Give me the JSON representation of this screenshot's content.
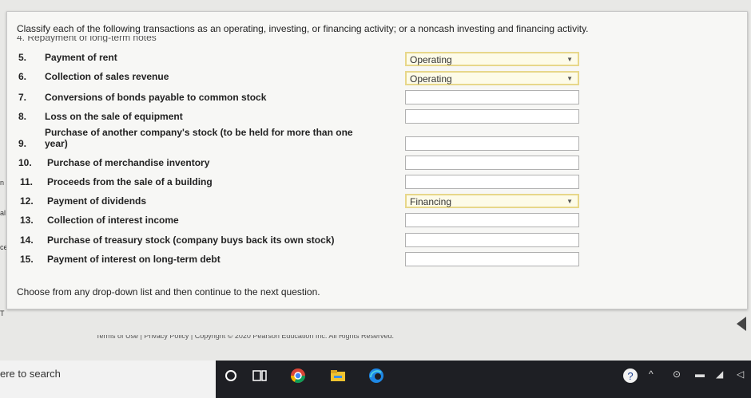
{
  "instructions": "Classify each of the following transactions as an operating, investing, or financing activity; or a noncash investing and financing activity.",
  "cut_row_text": "4.  Repayment of long-term notes",
  "items": [
    {
      "num": "5.",
      "text": "Payment of rent",
      "value": "Operating",
      "filled": true
    },
    {
      "num": "6.",
      "text": "Collection of sales revenue",
      "value": "Operating",
      "filled": true
    },
    {
      "num": "7.",
      "text": "Conversions of bonds payable to common stock",
      "value": "",
      "filled": false
    },
    {
      "num": "8.",
      "text": "Loss on the sale of equipment",
      "value": "",
      "filled": false
    },
    {
      "num": "9.",
      "text_line1": "Purchase of another company's stock (to be held for more than one",
      "text_line2": "year)",
      "value": "",
      "filled": false
    },
    {
      "num": "10.",
      "text": "Purchase of merchandise inventory",
      "value": "",
      "filled": false
    },
    {
      "num": "11.",
      "text": "Proceeds from the sale of a building",
      "value": "",
      "filled": false
    },
    {
      "num": "12.",
      "text": "Payment of dividends",
      "value": "Financing",
      "filled": true
    },
    {
      "num": "13.",
      "text": "Collection of interest income",
      "value": "",
      "filled": false
    },
    {
      "num": "14.",
      "text": "Purchase of treasury stock (company buys back its own stock)",
      "value": "",
      "filled": false
    },
    {
      "num": "15.",
      "text": "Payment of interest on long-term debt",
      "value": "",
      "filled": false
    }
  ],
  "hint": "Choose from any drop-down list and then continue to the next question.",
  "footer": "Terms of Use | Privacy Policy | Copyright © 2020 Pearson Education Inc. All Rights Reserved.",
  "left_marks": [
    "n",
    "al",
    "ce",
    "T"
  ],
  "taskbar": {
    "search_text": "ere to search"
  }
}
